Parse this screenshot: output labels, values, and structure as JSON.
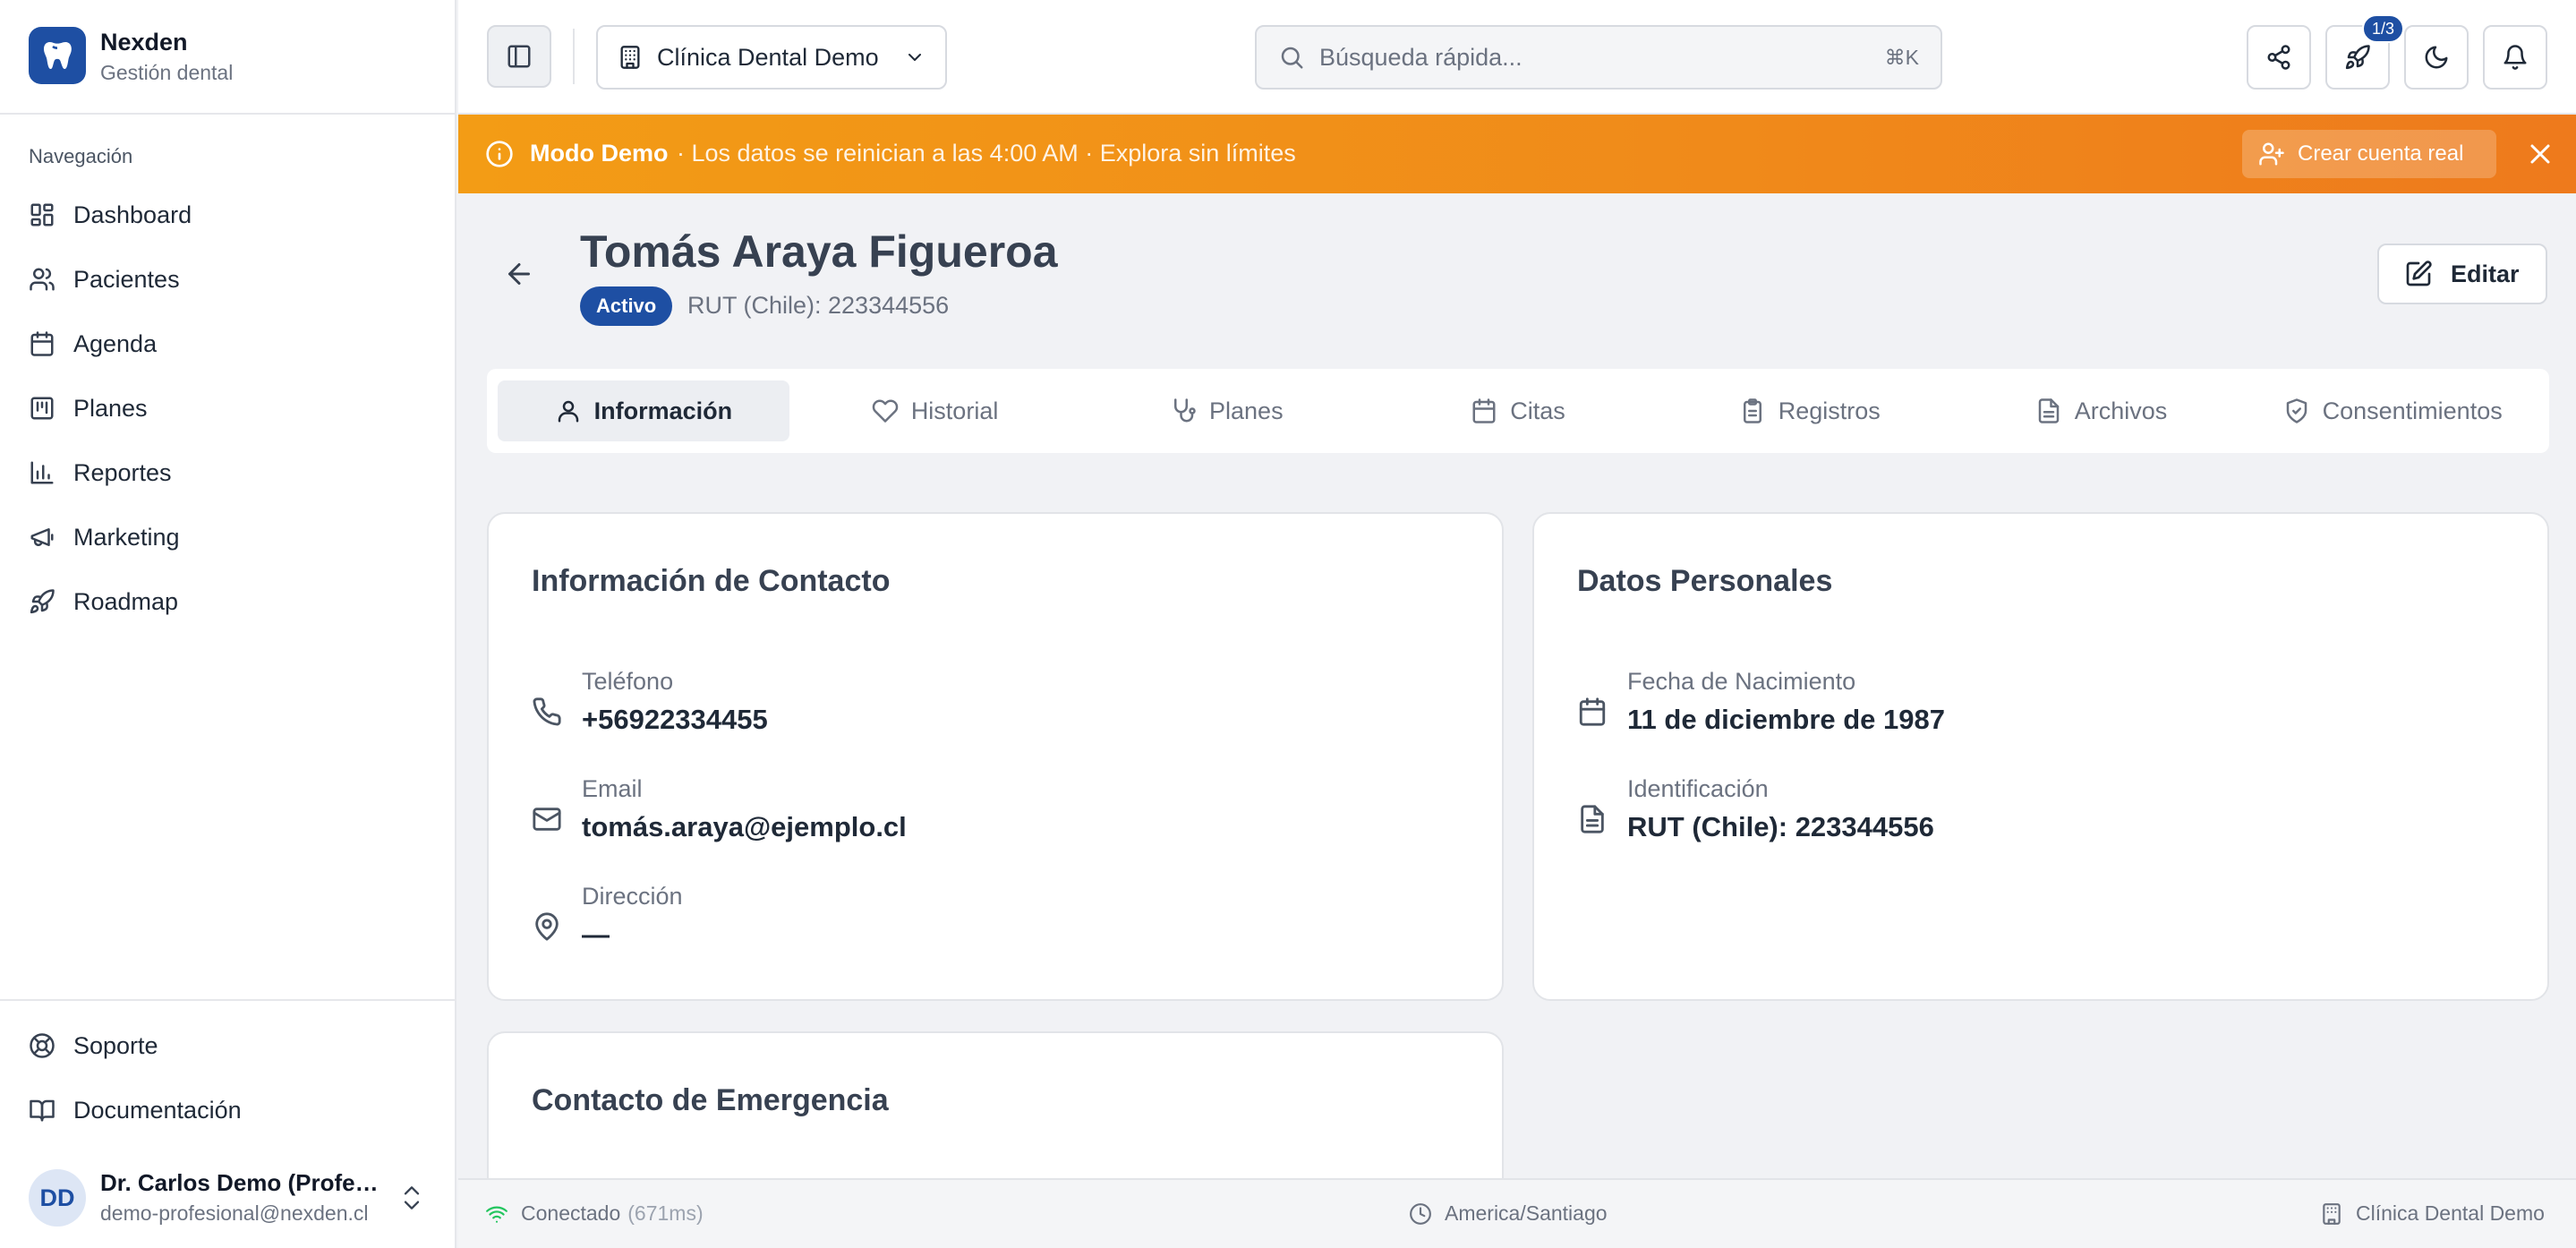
{
  "brand": {
    "name": "Nexden",
    "subtitle": "Gestión dental"
  },
  "nav": {
    "title": "Navegación",
    "items": [
      {
        "label": "Dashboard",
        "icon": "dashboard-icon"
      },
      {
        "label": "Pacientes",
        "icon": "users-icon"
      },
      {
        "label": "Agenda",
        "icon": "calendar-icon"
      },
      {
        "label": "Planes",
        "icon": "kanban-icon"
      },
      {
        "label": "Reportes",
        "icon": "bar-chart-icon"
      },
      {
        "label": "Marketing",
        "icon": "megaphone-icon"
      },
      {
        "label": "Roadmap",
        "icon": "rocket-icon"
      }
    ],
    "bottom": [
      {
        "label": "Soporte",
        "icon": "lifebuoy-icon"
      },
      {
        "label": "Documentación",
        "icon": "book-icon"
      }
    ]
  },
  "user": {
    "initials": "DD",
    "name": "Dr. Carlos Demo (Profesional)",
    "email": "demo-profesional@nexden.cl"
  },
  "topbar": {
    "clinic": "Clínica Dental Demo",
    "search_placeholder": "Búsqueda rápida...",
    "search_shortcut": "⌘K",
    "onboarding_badge": "1/3"
  },
  "banner": {
    "title": "Modo Demo",
    "text": "· Los datos se reinician a las 4:00 AM · Explora sin límites",
    "cta": "Crear cuenta real"
  },
  "patient": {
    "name": "Tomás Araya Figueroa",
    "status": "Activo",
    "id_text": "RUT (Chile): 223344556",
    "edit_label": "Editar"
  },
  "tabs": [
    {
      "label": "Información",
      "icon": "user-icon",
      "active": true
    },
    {
      "label": "Historial",
      "icon": "heart-icon",
      "active": false
    },
    {
      "label": "Planes",
      "icon": "stethoscope-icon",
      "active": false
    },
    {
      "label": "Citas",
      "icon": "calendar-icon",
      "active": false
    },
    {
      "label": "Registros",
      "icon": "clipboard-icon",
      "active": false
    },
    {
      "label": "Archivos",
      "icon": "file-icon",
      "active": false
    },
    {
      "label": "Consentimientos",
      "icon": "shield-check-icon",
      "active": false
    }
  ],
  "contact": {
    "title": "Información de Contacto",
    "phone_label": "Teléfono",
    "phone": "+56922334455",
    "email_label": "Email",
    "email": "tomás.araya@ejemplo.cl",
    "address_label": "Dirección",
    "address": "—"
  },
  "personal": {
    "title": "Datos Personales",
    "birth_label": "Fecha de Nacimiento",
    "birth": "11 de diciembre de 1987",
    "id_label": "Identificación",
    "id": "RUT (Chile): 223344556"
  },
  "emergency": {
    "title": "Contacto de Emergencia"
  },
  "statusbar": {
    "connection": "Conectado",
    "latency": "(671ms)",
    "timezone": "America/Santiago",
    "clinic": "Clínica Dental Demo"
  },
  "colors": {
    "brand": "#1e4fa3",
    "banner": "#f08a1a",
    "background": "#f1f2f5"
  }
}
